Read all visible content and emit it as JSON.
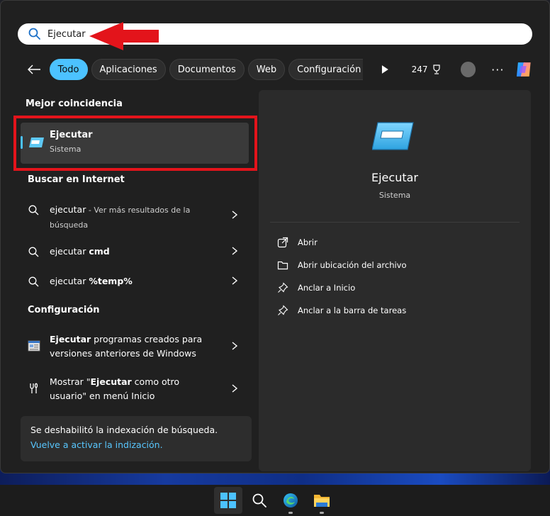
{
  "search": {
    "value": "Ejecutar"
  },
  "filters": {
    "chips": [
      "Todo",
      "Aplicaciones",
      "Documentos",
      "Web",
      "Configuración"
    ],
    "points": "247"
  },
  "left": {
    "best_match_title": "Mejor coincidencia",
    "best_match": {
      "name": "Ejecutar",
      "type": "Sistema"
    },
    "web_title": "Buscar en Internet",
    "web_results": [
      {
        "bold": "ejecutar",
        "rest": " - Ver más resultados de la",
        "line2": "búsqueda"
      },
      {
        "bold": "ejecutar ",
        "rest": "cmd"
      },
      {
        "bold": "ejecutar ",
        "rest": "%temp%"
      }
    ],
    "config_title": "Configuración",
    "config_results": [
      {
        "bold": "Ejecutar",
        "rest": " programas creados para",
        "line2": "versiones anteriores de Windows"
      },
      {
        "pre": "Mostrar \"",
        "bold": "Ejecutar",
        "rest": " como otro",
        "line2": "usuario\" en menú Inicio"
      }
    ],
    "notice": {
      "text": "Se deshabilitó la indexación de búsqueda.",
      "link": "Vuelve a activar la indización."
    }
  },
  "detail": {
    "name": "Ejecutar",
    "type": "Sistema",
    "actions": [
      "Abrir",
      "Abrir ubicación del archivo",
      "Anclar a Inicio",
      "Anclar a la barra de tareas"
    ]
  },
  "colors": {
    "accent": "#4cc2ff",
    "highlight": "#e3141b",
    "link": "#58c7ff"
  }
}
